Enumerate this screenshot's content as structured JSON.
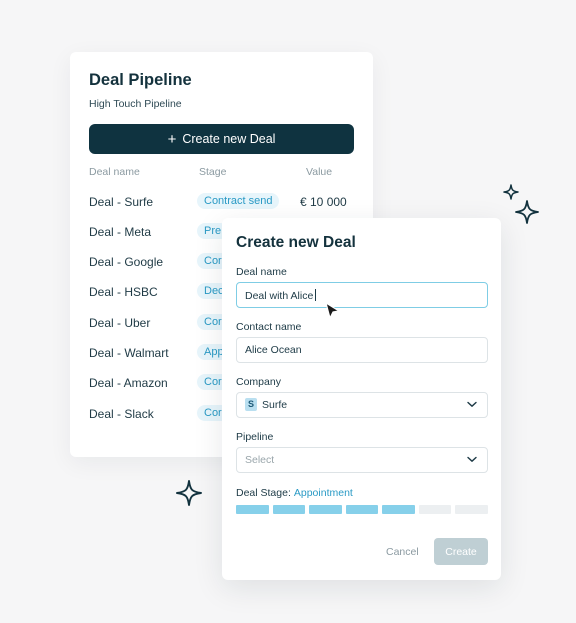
{
  "pipeline": {
    "title": "Deal Pipeline",
    "subtitle": "High Touch Pipeline",
    "create_button_label": "Create new Deal",
    "columns": {
      "name": "Deal name",
      "stage": "Stage",
      "value": "Value"
    },
    "rows": [
      {
        "name": "Deal - Surfe",
        "stage": "Contract send",
        "value": "€ 10 000"
      },
      {
        "name": "Deal - Meta",
        "stage": "Pre"
      },
      {
        "name": "Deal - Google",
        "stage": "Cor"
      },
      {
        "name": "Deal - HSBC",
        "stage": "Dec"
      },
      {
        "name": "Deal - Uber",
        "stage": "Cor"
      },
      {
        "name": "Deal - Walmart",
        "stage": "App"
      },
      {
        "name": "Deal - Amazon",
        "stage": "Cor"
      },
      {
        "name": "Deal - Slack",
        "stage": "Cor"
      }
    ]
  },
  "modal": {
    "title": "Create new Deal",
    "deal_name": {
      "label": "Deal name",
      "value": "Deal with Alice"
    },
    "contact_name": {
      "label": "Contact name",
      "value": "Alice Ocean"
    },
    "company": {
      "label": "Company",
      "value": "Surfe",
      "logo_letter": "S"
    },
    "pipeline": {
      "label": "Pipeline",
      "placeholder": "Select"
    },
    "deal_stage": {
      "label": "Deal Stage:",
      "value": "Appointment",
      "filled_segments": 5,
      "total_segments": 7
    },
    "cancel_label": "Cancel",
    "create_label": "Create"
  },
  "colors": {
    "primary": "#0f3340",
    "accent": "#2a9ac5",
    "badge_bg": "#e7f5fb",
    "stage_filled": "#86d0ea",
    "background": "#f6f6f7"
  },
  "icons": [
    "plus-icon",
    "chevron-down-icon",
    "sparkle-icon",
    "mouse-pointer-icon"
  ]
}
